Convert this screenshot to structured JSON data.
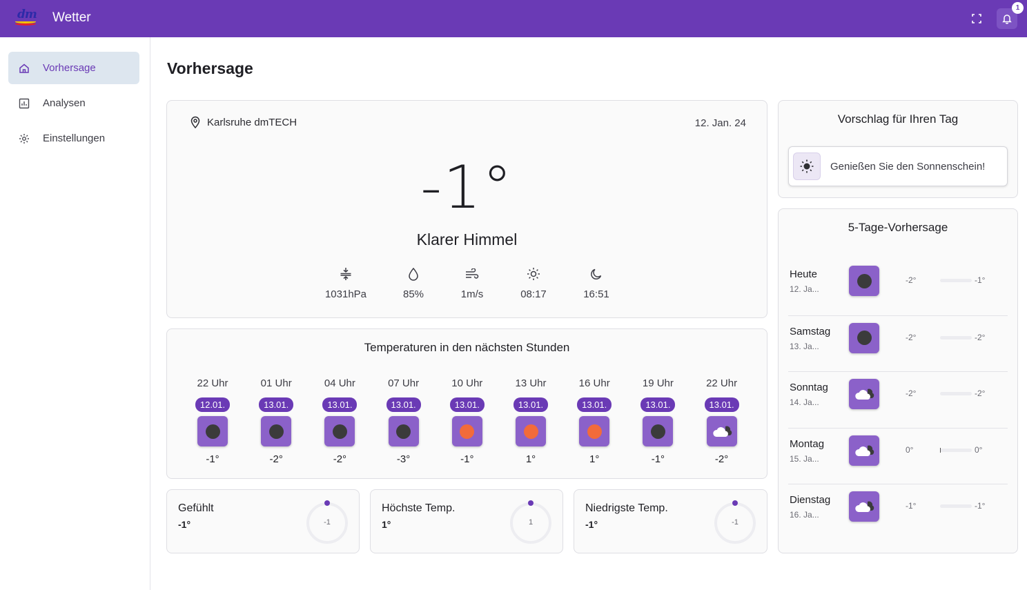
{
  "app": {
    "title": "Wetter",
    "notification_count": "1",
    "logo_text": "dm"
  },
  "colors": {
    "primary": "#6a3ab5",
    "icon_bg": "#8b61c9",
    "sun": "#f26b3a",
    "moon": "#3b3b3b"
  },
  "sidebar": {
    "items": [
      {
        "label": "Vorhersage",
        "icon": "home-icon",
        "active": true
      },
      {
        "label": "Analysen",
        "icon": "chart-icon",
        "active": false
      },
      {
        "label": "Einstellungen",
        "icon": "gear-icon",
        "active": false
      }
    ]
  },
  "page": {
    "title": "Vorhersage"
  },
  "current": {
    "location": "Karlsruhe dmTECH",
    "date": "12. Jan. 24",
    "temperature": "-1°",
    "condition": "Klarer Himmel",
    "stats": [
      {
        "icon": "pressure-icon",
        "value": "1031hPa"
      },
      {
        "icon": "humidity-icon",
        "value": "85%"
      },
      {
        "icon": "wind-icon",
        "value": "1m/s"
      },
      {
        "icon": "sunrise-icon",
        "value": "08:17"
      },
      {
        "icon": "sunset-icon",
        "value": "16:51"
      }
    ]
  },
  "hourly": {
    "title": "Temperaturen in den nächsten Stunden",
    "items": [
      {
        "hour": "22 Uhr",
        "date": "12.01.",
        "icon": "moon",
        "temp": "-1°"
      },
      {
        "hour": "01 Uhr",
        "date": "13.01.",
        "icon": "moon",
        "temp": "-2°"
      },
      {
        "hour": "04 Uhr",
        "date": "13.01.",
        "icon": "moon",
        "temp": "-2°"
      },
      {
        "hour": "07 Uhr",
        "date": "13.01.",
        "icon": "moon",
        "temp": "-3°"
      },
      {
        "hour": "10 Uhr",
        "date": "13.01.",
        "icon": "sun",
        "temp": "-1°"
      },
      {
        "hour": "13 Uhr",
        "date": "13.01.",
        "icon": "sun",
        "temp": "1°"
      },
      {
        "hour": "16 Uhr",
        "date": "13.01.",
        "icon": "sun",
        "temp": "1°"
      },
      {
        "hour": "19 Uhr",
        "date": "13.01.",
        "icon": "moon",
        "temp": "-1°"
      },
      {
        "hour": "22 Uhr",
        "date": "13.01.",
        "icon": "cloud",
        "temp": "-2°"
      }
    ]
  },
  "summary": [
    {
      "label": "Gefühlt",
      "value": "-1°",
      "gauge": "-1"
    },
    {
      "label": "Höchste Temp.",
      "value": "1°",
      "gauge": "1"
    },
    {
      "label": "Niedrigste Temp.",
      "value": "-1°",
      "gauge": "-1"
    }
  ],
  "suggestion": {
    "title": "Vorschlag für Ihren Tag",
    "text": "Genießen Sie den Sonnenschein!"
  },
  "forecast": {
    "title": "5-Tage-Vorhersage",
    "days": [
      {
        "day": "Heute",
        "date": "12. Ja...",
        "icon": "moon",
        "min": "-2°",
        "max": "-1°"
      },
      {
        "day": "Samstag",
        "date": "13. Ja...",
        "icon": "moon",
        "min": "-2°",
        "max": "-2°"
      },
      {
        "day": "Sonntag",
        "date": "14. Ja...",
        "icon": "cloud",
        "min": "-2°",
        "max": "-2°"
      },
      {
        "day": "Montag",
        "date": "15. Ja...",
        "icon": "cloud",
        "min": "0°",
        "max": "0°"
      },
      {
        "day": "Dienstag",
        "date": "16. Ja...",
        "icon": "cloud",
        "min": "-1°",
        "max": "-1°"
      }
    ]
  }
}
